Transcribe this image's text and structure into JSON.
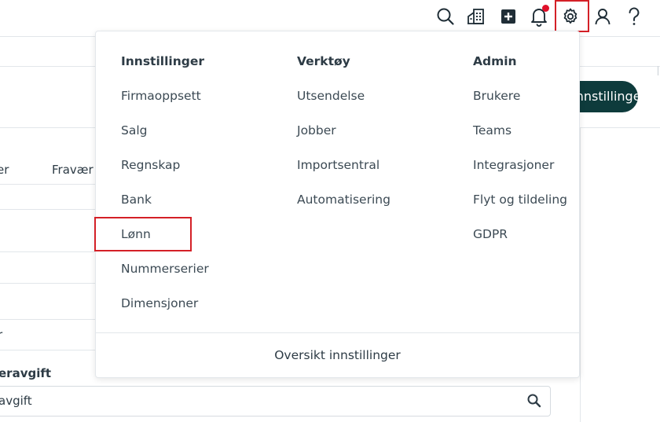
{
  "topbar": {
    "icons": [
      "search-icon",
      "company-icon",
      "plus-square-icon",
      "bell-icon",
      "gear-icon",
      "user-icon",
      "help-icon"
    ],
    "notification_dot_color": "#e0102a",
    "highlight_color": "#d42027"
  },
  "background": {
    "tab_partial": "er",
    "tab_fravaer": "Fravær",
    "button_label": "Innstillinger",
    "button_color": "#0e3b3c",
    "row_partial_1": "r",
    "section_label_partial": "eravgift",
    "search_value_partial": "avgift"
  },
  "menu": {
    "columns": [
      {
        "heading": "Innstillinger",
        "items": [
          "Firmaoppsett",
          "Salg",
          "Regnskap",
          "Bank",
          "Lønn",
          "Nummerserier",
          "Dimensjoner"
        ]
      },
      {
        "heading": "Verktøy",
        "items": [
          "Utsendelse",
          "Jobber",
          "Importsentral",
          "Automatisering"
        ]
      },
      {
        "heading": "Admin",
        "items": [
          "Brukere",
          "Teams",
          "Integrasjoner",
          "Flyt og tildeling",
          "GDPR"
        ]
      }
    ],
    "footer_link": "Oversikt innstillinger",
    "highlighted_item": "Lønn"
  }
}
